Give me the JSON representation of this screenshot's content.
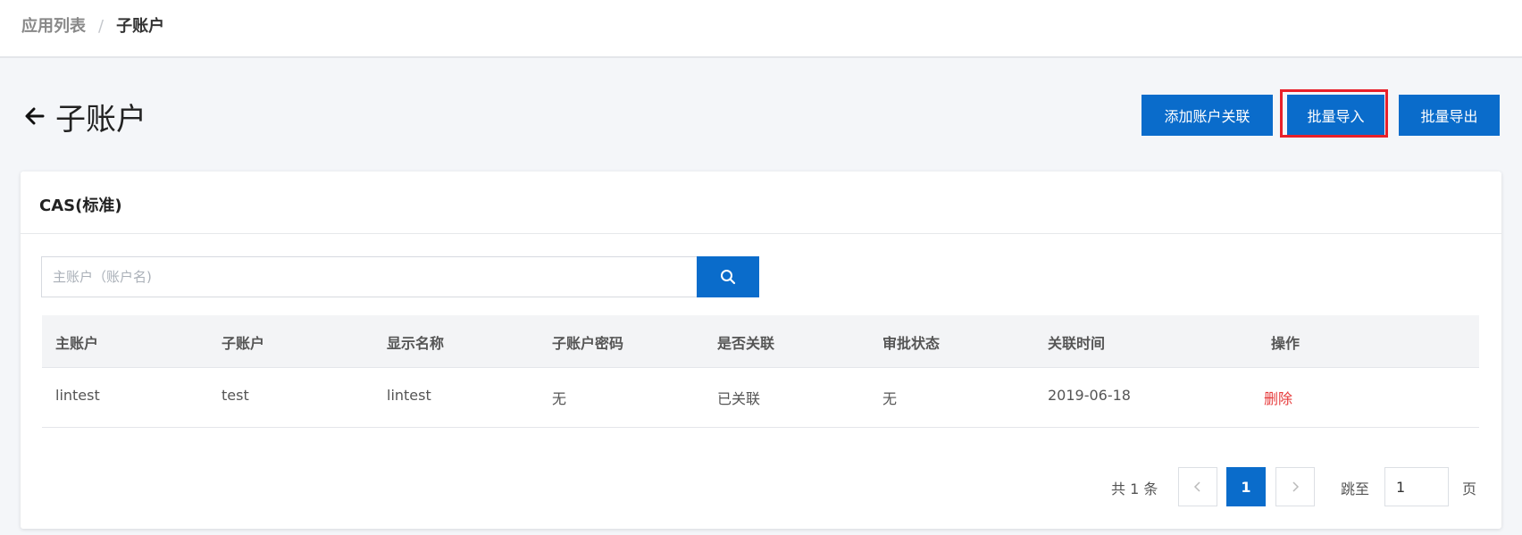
{
  "breadcrumb": {
    "parent": "应用列表",
    "separator": "/",
    "current": "子账户"
  },
  "header": {
    "back_icon": "arrow-left-icon",
    "title": "子账户"
  },
  "actions": {
    "add_label": "添加账户关联",
    "import_label": "批量导入",
    "export_label": "批量导出"
  },
  "card": {
    "title": "CAS(标准)"
  },
  "search": {
    "placeholder": "主账户（账户名)",
    "value": "",
    "icon": "search-icon"
  },
  "table": {
    "columns": [
      "主账户",
      "子账户",
      "显示名称",
      "子账户密码",
      "是否关联",
      "审批状态",
      "关联时间",
      "操作"
    ],
    "rows": [
      {
        "main_account": "lintest",
        "sub_account": "test",
        "display_name": "lintest",
        "sub_password": "无",
        "linked": "已关联",
        "approval": "无",
        "linked_time": "2019-06-18",
        "action": "删除"
      }
    ]
  },
  "pagination": {
    "total_label": "共 1 条",
    "prev": "<",
    "current_page": "1",
    "next": ">",
    "jump_label": "跳至",
    "jump_value": "1",
    "page_label": "页"
  },
  "colors": {
    "primary": "#0a6ccb",
    "danger": "#e63a3a",
    "highlight": "#e8202a"
  }
}
